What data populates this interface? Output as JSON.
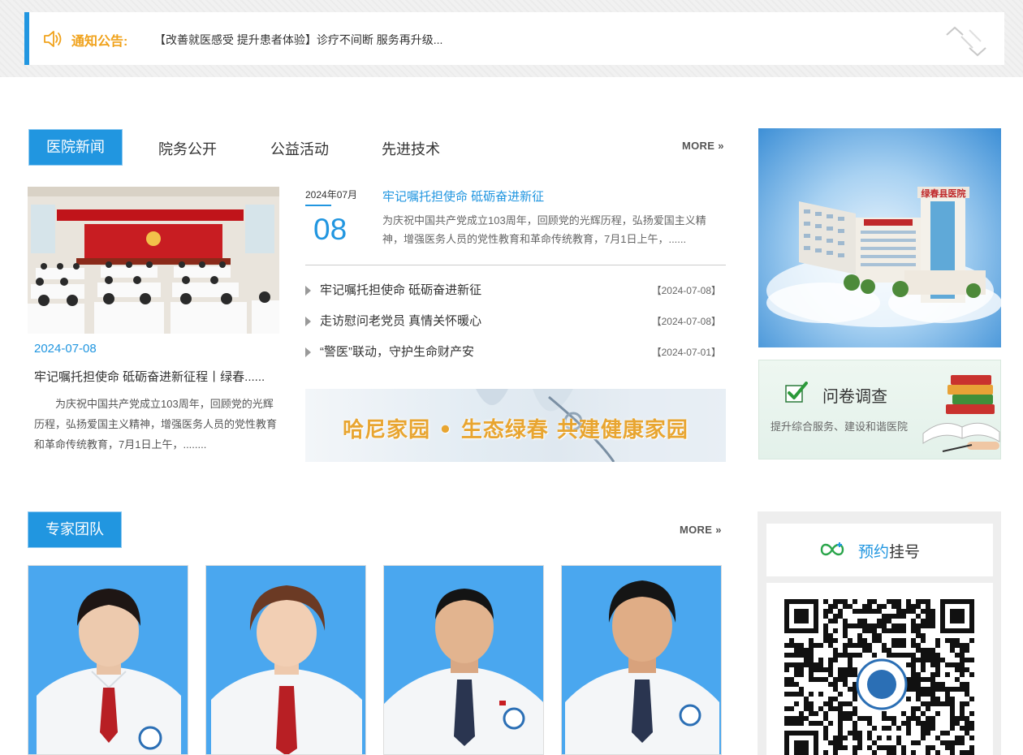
{
  "notice": {
    "label": "通知公告:",
    "text": "【改善就医感受 提升患者体验】诊疗不间断 服务再升级..."
  },
  "news": {
    "active_tab": "医院新闻",
    "tabs": [
      "院务公开",
      "公益活动",
      "先进技术"
    ],
    "more": "MORE",
    "feature": {
      "date": "2024-07-08",
      "title": "牢记嘱托担使命 砥砺奋进新征程丨绿春......",
      "summary": "为庆祝中国共产党成立103周年，回顾党的光辉历程，弘扬爱国主义精神，增强医务人员的党性教育和革命传统教育，7月1日上午，........"
    },
    "headline": {
      "year_month": "2024年07月",
      "day": "08",
      "title": "牢记嘱托担使命 砥砺奋进新征",
      "summary": "为庆祝中国共产党成立103周年，回顾党的光辉历程，弘扬爱国主义精神，增强医务人员的党性教育和革命传统教育，7月1日上午，......"
    },
    "items": [
      {
        "title": "牢记嘱托担使命 砥砺奋进新征",
        "date": "【2024-07-08】"
      },
      {
        "title": "走访慰问老党员 真情关怀暖心",
        "date": "【2024-07-08】"
      },
      {
        "title": "“警医”联动，守护生命财产安",
        "date": "【2024-07-01】"
      }
    ],
    "banner_text": "哈尼家园 • 生态绿春   共建健康家园"
  },
  "survey": {
    "title": "问卷调查",
    "subtitle": "提升综合服务、建设和谐医院"
  },
  "experts": {
    "title": "专家团队",
    "more": "MORE"
  },
  "registration": {
    "title_a": "预约",
    "title_b": "挂号"
  },
  "colors": {
    "accent": "#2196e0",
    "notice_label": "#f0a21b",
    "banner_text": "#e8a530",
    "doctor_bg": "#4aa7ef"
  }
}
